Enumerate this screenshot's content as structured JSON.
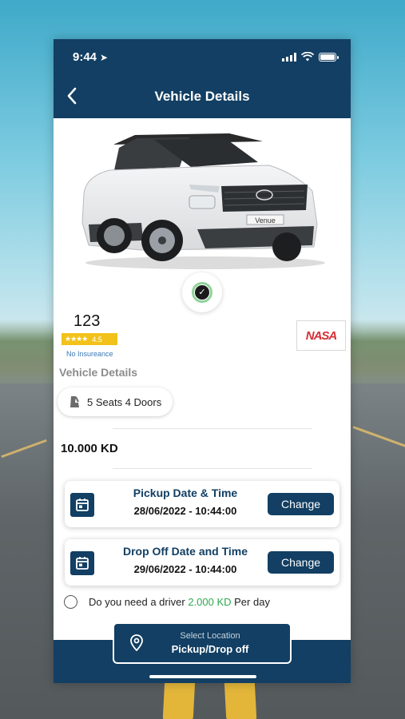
{
  "status_bar": {
    "time": "9:44"
  },
  "header": {
    "title": "Vehicle Details"
  },
  "car": {
    "name": "123",
    "rating": "4.5",
    "rating_stars": "★★★★",
    "insurance": "No Insureance",
    "brand": "NASA",
    "plate_text": "Venue"
  },
  "details": {
    "section_title": "Vehicle Details",
    "feature": "5 Seats 4 Doors",
    "price": "10.000 KD"
  },
  "pickup": {
    "title": "Pickup Date & Time",
    "value": "28/06/2022 - 10:44:00",
    "button": "Change"
  },
  "dropoff": {
    "title": "Drop Off Date and Time",
    "value": "29/06/2022 - 10:44:00",
    "button": "Change"
  },
  "driver": {
    "prefix": "Do you need a driver",
    "price": "2.000 KD",
    "suffix": "Per day"
  },
  "location": {
    "subtitle": "Select Location",
    "label": "Pickup/Drop off"
  },
  "colors": {
    "primary": "#123f63",
    "accent_green": "#2fa84f",
    "rating_yellow": "#f2c21b",
    "brand_red": "#d62e35"
  }
}
